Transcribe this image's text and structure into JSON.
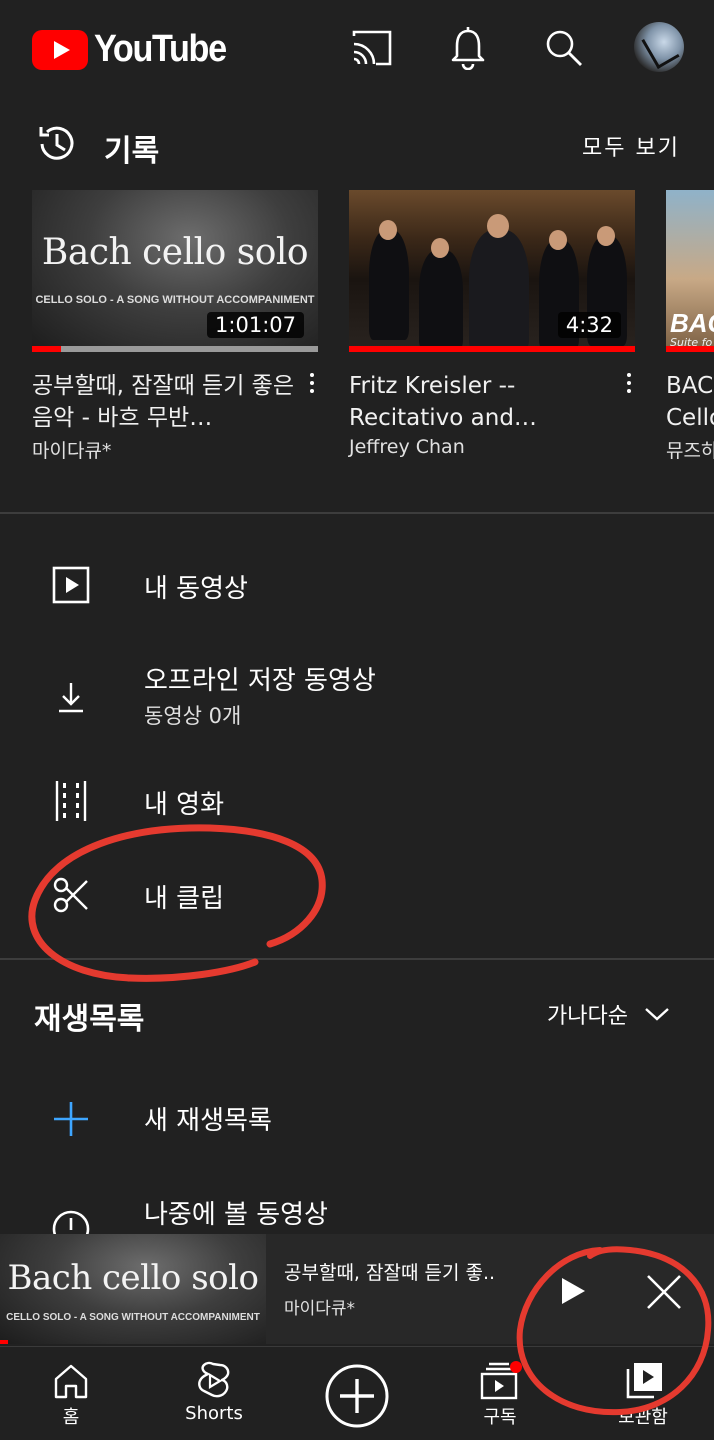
{
  "app": {
    "logo_text": "YouTube",
    "brand_color": "#ff0000"
  },
  "header": {
    "icons": [
      "cast-icon",
      "bell-icon",
      "search-icon",
      "avatar"
    ]
  },
  "history": {
    "title": "기록",
    "see_all": "모두 보기",
    "videos": [
      {
        "thumb_title": "Bach cello solo",
        "thumb_subtitle": "CELLO SOLO - A SONG WITHOUT ACCOMPANIMENT",
        "duration": "1:01:07",
        "progress": 0.1,
        "title": "공부할때, 잠잘때 듣기 좋은 음악 - 바흐 무반…",
        "channel": "마이다큐*"
      },
      {
        "duration": "4:32",
        "progress": 1.0,
        "title": "Fritz Kreisler -- Recitativo and…",
        "channel": "Jeffrey Chan"
      },
      {
        "thumb_label": "BAC",
        "thumb_sub": "Suite fo",
        "title": "BAC Cello",
        "channel": "뮤즈하"
      }
    ]
  },
  "library": {
    "items": [
      {
        "label": "내 동영상",
        "icon": "play-box-icon"
      },
      {
        "label": "오프라인 저장 동영상",
        "sub": "동영상 0개",
        "icon": "download-icon"
      },
      {
        "label": "내 영화",
        "icon": "film-icon"
      },
      {
        "label": "내 클립",
        "icon": "scissors-icon"
      }
    ]
  },
  "playlists": {
    "title": "재생목록",
    "sort_label": "가나다순",
    "new_playlist": "새 재생목록",
    "watch_later": "나중에 볼 동영상"
  },
  "mini_player": {
    "thumb_title": "Bach cello solo",
    "thumb_subtitle": "CELLO SOLO - A SONG WITHOUT ACCOMPANIMENT",
    "title": "공부할때, 잠잘때 듣기 좋..",
    "channel": "마이다큐*"
  },
  "bottom_nav": {
    "items": [
      {
        "label": "홈",
        "icon": "home-icon"
      },
      {
        "label": "Shorts",
        "icon": "shorts-icon"
      },
      {
        "label": "",
        "icon": "create-icon"
      },
      {
        "label": "구독",
        "icon": "subscriptions-icon"
      },
      {
        "label": "보관함",
        "icon": "library-icon"
      }
    ]
  },
  "annotation_color": "#e53a2f"
}
